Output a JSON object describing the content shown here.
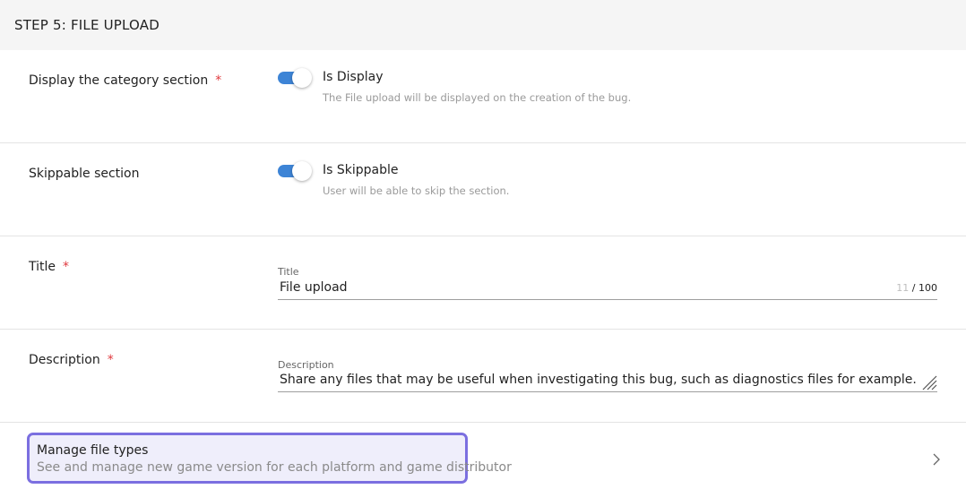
{
  "header": {
    "title": "STEP 5: FILE UPLOAD"
  },
  "display_section": {
    "label": "Display the category section",
    "required_mark": "*",
    "toggle_on": true,
    "toggle_label": "Is Display",
    "hint": "The File upload will be displayed on the creation of the bug."
  },
  "skippable_section": {
    "label": "Skippable section",
    "toggle_on": true,
    "toggle_label": "Is Skippable",
    "hint": "User will be able to skip the section."
  },
  "title_section": {
    "label": "Title",
    "required_mark": "*",
    "field_label": "Title",
    "value": "File upload",
    "count": "11",
    "separator": "/",
    "max": "100"
  },
  "description_section": {
    "label": "Description",
    "required_mark": "*",
    "field_label": "Description",
    "value": "Share any files that may be useful when investigating this bug, such as diagnostics files for example."
  },
  "manage_file_types": {
    "title": "Manage file types",
    "subtitle": "See and manage new game version for each platform and game distributor"
  },
  "colors": {
    "accent": "#3d84d6",
    "required": "#e0393e",
    "focus_border": "#7b6fe0",
    "header_bg": "#f5f5f5"
  }
}
